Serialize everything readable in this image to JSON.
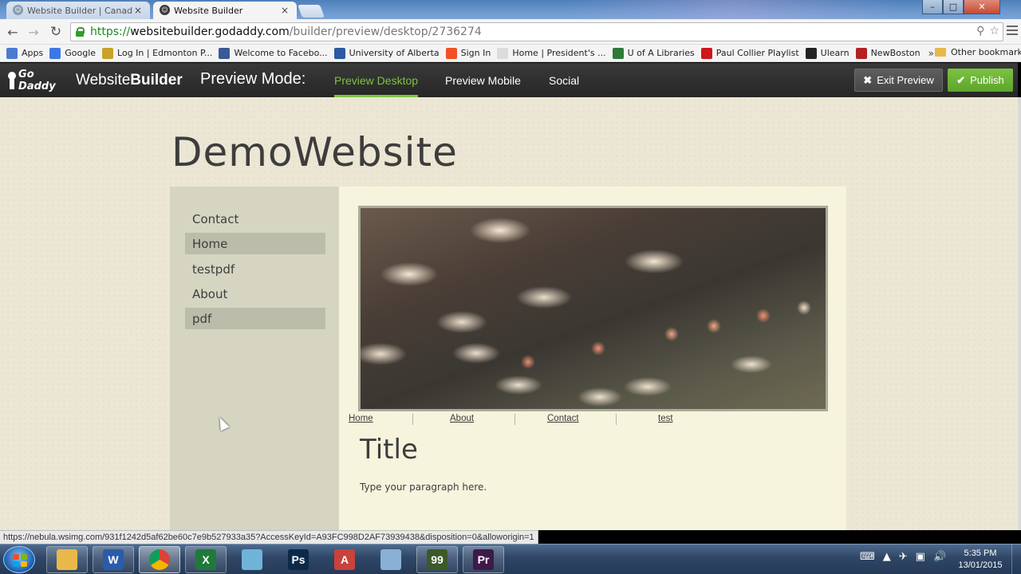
{
  "browser": {
    "tabs": [
      {
        "label": "Website Builder | Canadian",
        "favicon": "godaddy-icon",
        "active": false
      },
      {
        "label": "Website Builder",
        "favicon": "godaddy-icon",
        "active": true
      }
    ],
    "url": {
      "scheme": "https://",
      "host": "websitebuilder.godaddy.com",
      "path": "/builder/preview/desktop/2736274"
    },
    "bookmarks": [
      {
        "label": "Apps",
        "icon": "apps-grid-icon",
        "color": "#4a7bd0"
      },
      {
        "label": "Google",
        "icon": "google-icon",
        "color": "#3b78e7"
      },
      {
        "label": "Log In | Edmonton P...",
        "icon": "library-icon",
        "color": "#c9a22a"
      },
      {
        "label": "Welcome to Facebo...",
        "icon": "facebook-icon",
        "color": "#3b5998"
      },
      {
        "label": "University of Alberta",
        "icon": "ualberta-icon",
        "color": "#2c5aa0"
      },
      {
        "label": "Sign In",
        "icon": "windows-icon",
        "color": "#f25022"
      },
      {
        "label": "Home | President's ...",
        "icon": "page-icon",
        "color": "#dcdcdc"
      },
      {
        "label": "U of A Libraries",
        "icon": "shield-icon",
        "color": "#2f7a3a"
      },
      {
        "label": "Paul Collier Playlist",
        "icon": "youtube-icon",
        "color": "#cc181e"
      },
      {
        "label": "Ulearn",
        "icon": "ulearn-icon",
        "color": "#222222"
      },
      {
        "label": "NewBoston",
        "icon": "newboston-icon",
        "color": "#b22222"
      }
    ],
    "bookmarks_overflow": "»",
    "other_bookmarks": "Other bookmark",
    "status_url": "https://nebula.wsimg.com/931f1242d5af62be60c7e9b527933a35?AccessKeyId=A93FC998D2AF73939438&disposition=0&alloworigin=1"
  },
  "builder": {
    "brand_prefix": "Website",
    "brand_bold": "Builder",
    "mode_label": "Preview Mode:",
    "tabs": [
      {
        "label": "Preview Desktop",
        "active": true
      },
      {
        "label": "Preview Mobile",
        "active": false
      },
      {
        "label": "Social",
        "active": false
      }
    ],
    "exit_label": "Exit Preview",
    "publish_label": "Publish",
    "accent": "#7fc241"
  },
  "site": {
    "title": "DemoWebsite",
    "nav": [
      {
        "label": "Contact",
        "highlighted": false
      },
      {
        "label": "Home",
        "highlighted": true
      },
      {
        "label": "testpdf",
        "highlighted": false
      },
      {
        "label": "About",
        "highlighted": false
      },
      {
        "label": "pdf",
        "highlighted": true
      }
    ],
    "subnav": [
      "Home",
      "About",
      "Contact",
      "test"
    ],
    "content_title": "Title",
    "content_paragraph": "Type your paragraph here."
  },
  "taskbar": {
    "apps": [
      {
        "name": "explorer",
        "icon": "folder-icon",
        "color": "#e8b84a",
        "glyph": "",
        "state": "run"
      },
      {
        "name": "word",
        "icon": "word-icon",
        "color": "#2a5caa",
        "glyph": "W",
        "state": "run"
      },
      {
        "name": "chrome",
        "icon": "chrome-icon",
        "color": "#db4437",
        "glyph": "",
        "state": "act"
      },
      {
        "name": "excel",
        "icon": "excel-icon",
        "color": "#1f7a3a",
        "glyph": "X",
        "state": "run"
      },
      {
        "name": "notepad",
        "icon": "pen-icon",
        "color": "#6fb3d9",
        "glyph": "",
        "state": "none"
      },
      {
        "name": "photoshop",
        "icon": "photoshop-icon",
        "color": "#0b2a4a",
        "glyph": "Ps",
        "state": "none"
      },
      {
        "name": "access",
        "icon": "access-icon",
        "color": "#c9423b",
        "glyph": "A",
        "state": "none"
      },
      {
        "name": "calculator",
        "icon": "calculator-icon",
        "color": "#8ab0d6",
        "glyph": "",
        "state": "none"
      },
      {
        "name": "task-manager",
        "icon": "monitor-icon",
        "color": "#3a5a2a",
        "glyph": "99",
        "state": "run"
      },
      {
        "name": "premiere",
        "icon": "premiere-icon",
        "color": "#3d1a4a",
        "glyph": "Pr",
        "state": "run"
      }
    ],
    "time": "5:35 PM",
    "date": "13/01/2015"
  }
}
